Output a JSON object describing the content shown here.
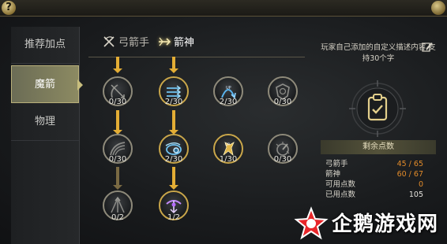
{
  "sidebar": {
    "items": [
      {
        "label": "推荐加点",
        "active": false
      },
      {
        "label": "魔箭",
        "active": true
      },
      {
        "label": "物理",
        "active": false
      }
    ]
  },
  "tabs": [
    {
      "label": "弓箭手",
      "icon": "crossed-bows-icon",
      "active": false
    },
    {
      "label": "箭神",
      "icon": "winged-arrow-icon",
      "active": true
    }
  ],
  "skills": [
    {
      "level": "0/30",
      "icon": "bow-shot-icon",
      "lit": false
    },
    {
      "level": "2/30",
      "icon": "triple-arrow-icon",
      "lit": true
    },
    {
      "level": "2/30",
      "icon": "arc-up-arrow-icon",
      "lit": true
    },
    {
      "level": "0/30",
      "icon": "shield-emblem-icon",
      "lit": false
    },
    {
      "level": "0/30",
      "icon": "arrow-rain-icon",
      "lit": false
    },
    {
      "level": "2/30",
      "icon": "spiral-arrow-icon",
      "lit": true
    },
    {
      "level": "1/30",
      "icon": "golden-beast-icon",
      "lit": true
    },
    {
      "level": "0/30",
      "icon": "burst-icon",
      "lit": false
    },
    {
      "level": "0/2",
      "icon": "arrow-fan-icon",
      "lit": false
    },
    {
      "level": "1/2",
      "icon": "purple-winged-bow-icon",
      "lit": true
    }
  ],
  "panel": {
    "description": "玩家自己添加的自定义描述内容,支持30个字",
    "points_header": "剩余点数",
    "rows": [
      {
        "label": "弓箭手",
        "value": "45 / 65",
        "color": "orange"
      },
      {
        "label": "箭神",
        "value": "60 / 67",
        "color": "orange"
      },
      {
        "label": "可用点数",
        "value": "0",
        "color": "orange"
      },
      {
        "label": "已用点数",
        "value": "105",
        "color": "white"
      }
    ]
  },
  "watermark": {
    "text": "企鹅游戏网"
  },
  "colors": {
    "accent_gold": "#e3ad35",
    "value_orange": "#e08a2a"
  }
}
